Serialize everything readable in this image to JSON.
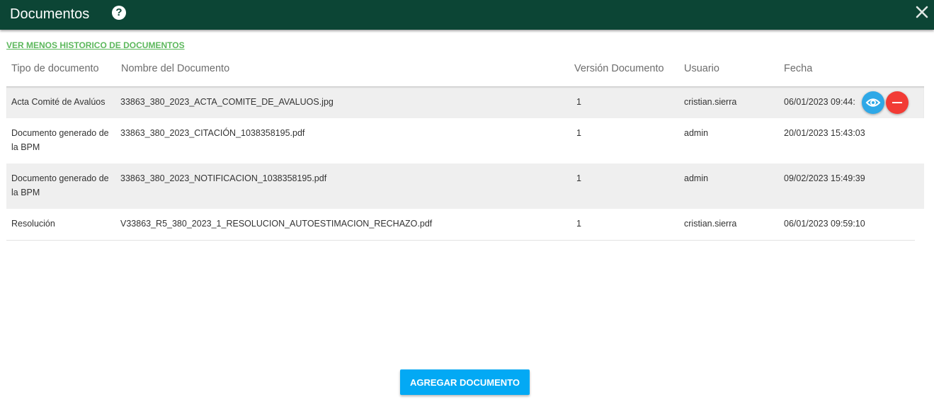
{
  "header": {
    "title": "Documentos",
    "help_glyph": "?",
    "help_icon": "question-circle-icon",
    "close_icon": "close-icon"
  },
  "history_link": "VER MENOS HISTORICO DE DOCUMENTOS",
  "columns": [
    "Tipo de documento",
    "Nombre del Documento",
    "Versión Documento",
    "Usuario",
    "Fecha"
  ],
  "rows": [
    {
      "tipo": "Acta Comité de Avalúos",
      "nombre": "33863_380_2023_ACTA_COMITE_DE_AVALUOS.jpg",
      "version": "1",
      "usuario": "cristian.sierra",
      "fecha": "06/01/2023 09:44:"
    },
    {
      "tipo": "Documento generado de la BPM",
      "nombre": "33863_380_2023_CITACIÓN_1038358195.pdf",
      "version": "1",
      "usuario": "admin",
      "fecha": "20/01/2023 15:43:03"
    },
    {
      "tipo": "Documento generado de la BPM",
      "nombre": "33863_380_2023_NOTIFICACION_1038358195.pdf",
      "version": "1",
      "usuario": "admin",
      "fecha": "09/02/2023 15:49:39"
    },
    {
      "tipo": "Resolución",
      "nombre": "V33863_R5_380_2023_1_RESOLUCION_AUTOESTIMACION_RECHAZO.pdf",
      "version": "1",
      "usuario": "cristian.sierra",
      "fecha": "06/01/2023 09:59:10"
    }
  ],
  "row_actions": {
    "view_icon": "eye-icon",
    "delete_icon": "minus-icon"
  },
  "add_button": "AGREGAR DOCUMENTO",
  "colors": {
    "header_bg": "#0c4535",
    "link": "#5cb85c",
    "primary": "#03a9f4",
    "view": "#2ea8e7",
    "danger": "#f23b35"
  }
}
